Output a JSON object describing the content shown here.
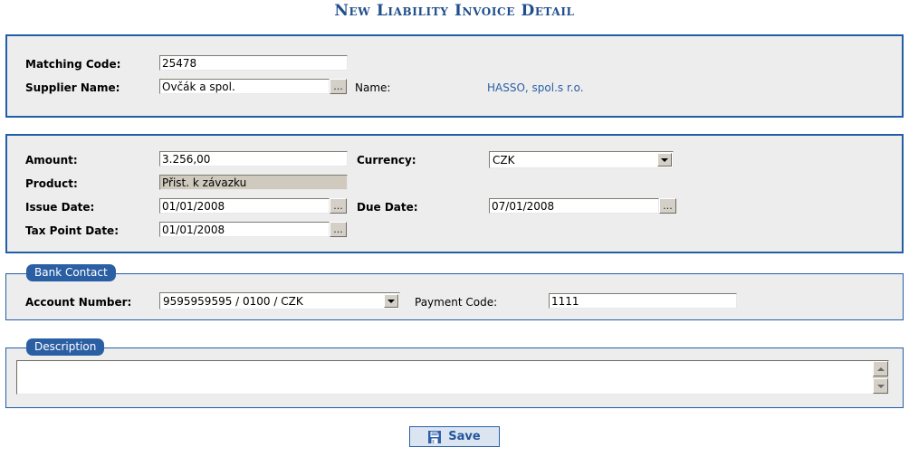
{
  "page": {
    "title": "New Liability Invoice Detail",
    "accent_color": "#225ea8",
    "panel_bg": "#ededed",
    "link_color": "#2a5fa5"
  },
  "supplier_panel": {
    "matching_code": {
      "label": "Matching Code:",
      "value": "25478"
    },
    "supplier_name": {
      "label": "Supplier Name:",
      "value": "Ovčák a spol.",
      "browse_label": "..."
    },
    "name": {
      "label": "Name:",
      "value": "HASSO, spol.s r.o."
    }
  },
  "invoice_panel": {
    "amount": {
      "label": "Amount:",
      "value": "3.256,00"
    },
    "currency": {
      "label": "Currency:",
      "value": "CZK",
      "options": [
        "CZK"
      ]
    },
    "product": {
      "label": "Product:",
      "value": "Přist. k závazku"
    },
    "issue_date": {
      "label": "Issue Date:",
      "value": "01/01/2008",
      "browse_label": "..."
    },
    "due_date": {
      "label": "Due Date:",
      "value": "07/01/2008",
      "browse_label": "..."
    },
    "tax_point_date": {
      "label": "Tax Point Date:",
      "value": "01/01/2008",
      "browse_label": "..."
    }
  },
  "bank_contact": {
    "legend": "Bank Contact",
    "account_number": {
      "label": "Account Number:",
      "value": "9595959595 / 0100 / CZK",
      "options": [
        "9595959595 / 0100 / CZK"
      ]
    },
    "payment_code": {
      "label": "Payment Code:",
      "value": "1111"
    }
  },
  "description": {
    "legend": "Description",
    "textarea": {
      "value": "",
      "placeholder": ""
    }
  },
  "footer": {
    "save": {
      "label": "Save",
      "icon": "floppy-disk-icon"
    }
  }
}
